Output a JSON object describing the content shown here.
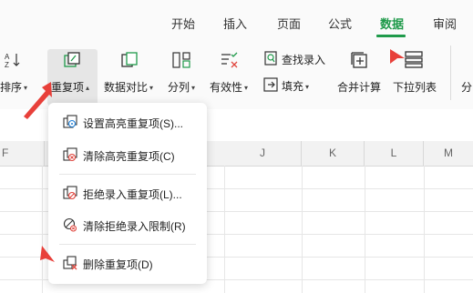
{
  "tabs": [
    {
      "label": "开始",
      "active": false
    },
    {
      "label": "插入",
      "active": false
    },
    {
      "label": "页面",
      "active": false
    },
    {
      "label": "公式",
      "active": false
    },
    {
      "label": "数据",
      "active": true
    },
    {
      "label": "审阅",
      "active": false
    }
  ],
  "ribbon": {
    "sort_label": "排序",
    "duplicates_label": "重复项",
    "compare_label": "数据对比",
    "split_label": "分列",
    "validity_label": "有效性",
    "find_entry_label": "查找录入",
    "fill_label": "填充",
    "merge_calc_label": "合并计算",
    "dropdown_list_label": "下拉列表",
    "partial_label": "分"
  },
  "columns": [
    "F",
    "J",
    "K",
    "L",
    "M"
  ],
  "menu": {
    "items": [
      {
        "label": "设置高亮重复项(S)...",
        "icon": "highlight-duplicates-icon"
      },
      {
        "label": "清除高亮重复项(C)",
        "icon": "clear-highlight-icon"
      },
      {
        "label": "拒绝录入重复项(L)...",
        "icon": "reject-duplicates-icon"
      },
      {
        "label": "清除拒绝录入限制(R)",
        "icon": "clear-restriction-icon"
      },
      {
        "label": "删除重复项(D)",
        "icon": "delete-duplicates-icon"
      }
    ]
  },
  "colors": {
    "accent": "#1f9a4a",
    "arrow": "#e8403a",
    "icon_red": "#e0443c"
  }
}
